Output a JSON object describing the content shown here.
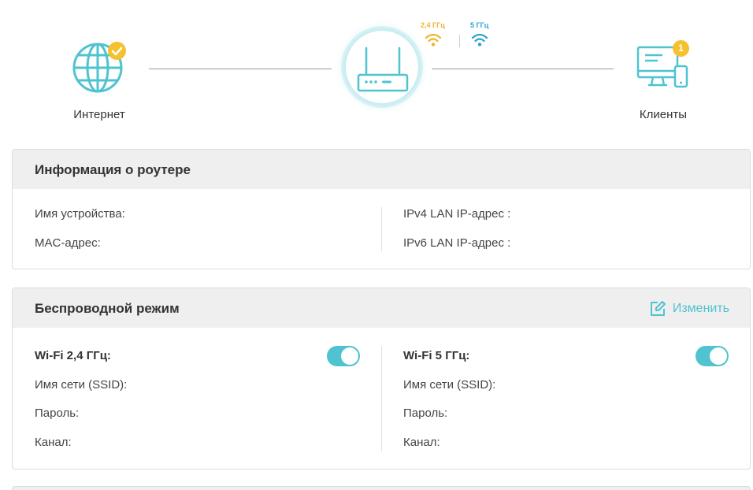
{
  "topology": {
    "internet_label": "Интернет",
    "clients_label": "Клиенты",
    "clients_count": "1",
    "band_24_label": "2,4 ГГц",
    "band_5_label": "5 ГГц",
    "colors": {
      "accent": "#4fc3cf",
      "badge": "#f5c12e",
      "band24": "#f0b429",
      "band5": "#2aa3cf"
    }
  },
  "router_info": {
    "title": "Информация о роутере",
    "device_name_label": "Имя устройства:",
    "mac_label": "MAC-адрес:",
    "ipv4_label": "IPv4 LAN IP-адрес :",
    "ipv6_label": "IPv6 LAN IP-адрес :"
  },
  "wireless": {
    "title": "Беспроводной режим",
    "edit_label": "Изменить",
    "band24": {
      "title": "Wi-Fi 2,4 ГГц:",
      "enabled": true,
      "ssid_label": "Имя сети (SSID):",
      "password_label": "Пароль:",
      "channel_label": "Канал:"
    },
    "band5": {
      "title": "Wi-Fi 5 ГГц:",
      "enabled": true,
      "ssid_label": "Имя сети (SSID):",
      "password_label": "Пароль:",
      "channel_label": "Канал:"
    }
  }
}
